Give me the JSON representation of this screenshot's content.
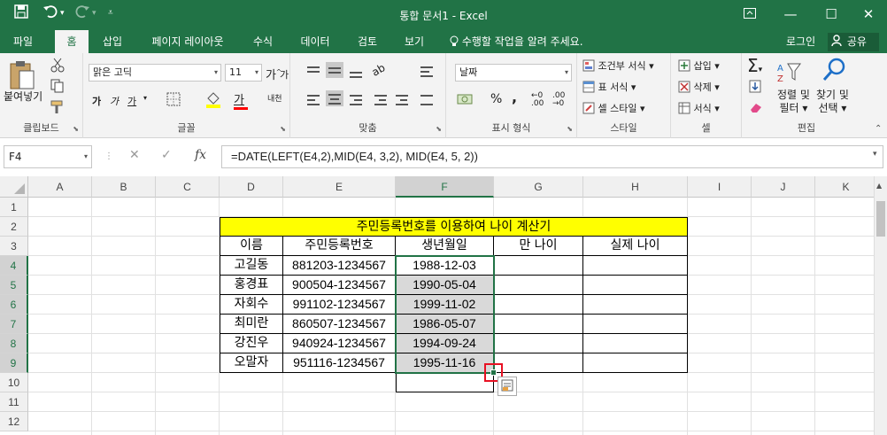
{
  "window": {
    "title": "통합 문서1  -  Excel",
    "quick_access": [
      "save-icon",
      "undo-icon",
      "redo-icon",
      "customize-icon"
    ],
    "buttons": [
      "ribbon-options-icon",
      "minimize-icon",
      "maximize-icon",
      "close-icon"
    ]
  },
  "tabs": [
    "파일",
    "홈",
    "삽입",
    "페이지 레이아웃",
    "수식",
    "데이터",
    "검토",
    "보기"
  ],
  "active_tab": "홈",
  "tell_me": "수행할 작업을 알려 주세요.",
  "account": {
    "login": "로그인",
    "share": "공유"
  },
  "ribbon": {
    "clipboard": {
      "label": "클립보드",
      "paste": "붙여넣기"
    },
    "font": {
      "label": "글꼴",
      "name": "맑은 고딕",
      "size": "11",
      "bold": "가",
      "italic": "가",
      "underline": "가",
      "grow": "가",
      "shrink": "가",
      "font_color": "가",
      "phonetic": "내천"
    },
    "alignment": {
      "label": "맞춤"
    },
    "number": {
      "label": "표시 형식",
      "format": "날짜",
      "percent": "%",
      "comma": ","
    },
    "styles": {
      "label": "스타일",
      "cond": "조건부 서식",
      "table": "표 서식",
      "cell": "셀 스타일"
    },
    "cells": {
      "label": "셀",
      "insert": "삽입",
      "delete": "삭제",
      "format": "서식"
    },
    "editing": {
      "label": "편집",
      "sort1": "정렬 및",
      "sort2": "필터",
      "find1": "찾기 및",
      "find2": "선택"
    }
  },
  "accent": "#217346",
  "formula_bar": {
    "name_box": "F4",
    "cancel": "✕",
    "enter": "✓",
    "fx": "fx",
    "formula": "=DATE(LEFT(E4,2),MID(E4, 3,2), MID(E4, 5, 2))"
  },
  "sheet": {
    "columns": [
      "A",
      "B",
      "C",
      "D",
      "E",
      "F",
      "G",
      "H",
      "I",
      "J",
      "K"
    ],
    "rows": [
      "1",
      "2",
      "3",
      "4",
      "5",
      "6",
      "7",
      "8",
      "9",
      "10",
      "11",
      "12"
    ],
    "selected_column": "F",
    "title_cell": "주민등록번호를 이용하여 나이 계산기",
    "title_fill": "#ffff00",
    "headers": [
      "이름",
      "주민등록번호",
      "생년월일",
      "만 나이",
      "실제 나이"
    ],
    "records": [
      {
        "name": "고길동",
        "rrn": "881203-1234567",
        "birth": "1988-12-03",
        "age": "",
        "real_age": ""
      },
      {
        "name": "홍경표",
        "rrn": "900504-1234567",
        "birth": "1990-05-04",
        "age": "",
        "real_age": ""
      },
      {
        "name": "자회수",
        "rrn": "991102-1234567",
        "birth": "1999-11-02",
        "age": "",
        "real_age": ""
      },
      {
        "name": "최미란",
        "rrn": "860507-1234567",
        "birth": "1986-05-07",
        "age": "",
        "real_age": ""
      },
      {
        "name": "강진우",
        "rrn": "940924-1234567",
        "birth": "1994-09-24",
        "age": "",
        "real_age": ""
      },
      {
        "name": "오말자",
        "rrn": "951116-1234567",
        "birth": "1995-11-16",
        "age": "",
        "real_age": ""
      }
    ],
    "selection_fill": "#d9d9d9",
    "highlight_color": "#e81123"
  }
}
